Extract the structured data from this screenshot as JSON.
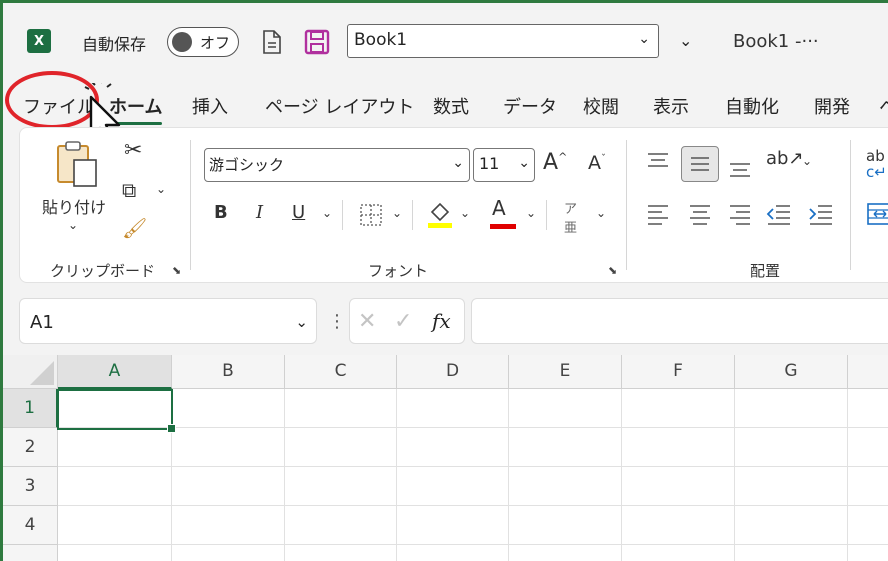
{
  "titlebar": {
    "autosave_label": "自動保存",
    "toggle_state": "オフ",
    "filename": "Book1",
    "title": "Book1 -···",
    "qat_more": "⌄"
  },
  "tabs": [
    {
      "label": "ファイル"
    },
    {
      "label": "ホーム"
    },
    {
      "label": "挿入"
    },
    {
      "label": "ページ レイアウト"
    },
    {
      "label": "数式"
    },
    {
      "label": "データ"
    },
    {
      "label": "校閲"
    },
    {
      "label": "表示"
    },
    {
      "label": "自動化"
    },
    {
      "label": "開発"
    },
    {
      "label": "ヘ"
    }
  ],
  "ribbon": {
    "paste_label": "貼り付け",
    "clipboard_group": "クリップボード",
    "font_group": "フォント",
    "alignment_group": "配置",
    "font_name": "游ゴシック",
    "font_size": "11",
    "bold": "B",
    "italic": "I",
    "underline": "U",
    "font_color_glyph": "A",
    "grow_font": "A",
    "shrink_font": "A",
    "wrap_text": "ab"
  },
  "formula_bar": {
    "name_box": "A1",
    "fx": "fx"
  },
  "grid": {
    "columns": [
      "A",
      "B",
      "C",
      "D",
      "E",
      "F",
      "G"
    ],
    "rows": [
      "1",
      "2",
      "3",
      "4"
    ]
  },
  "colors": {
    "accent": "#1d6f42",
    "highlight": "#e0242a",
    "fill_color": "#ffff00",
    "font_color": "#ff0000",
    "save_icon": "#b0309e"
  }
}
